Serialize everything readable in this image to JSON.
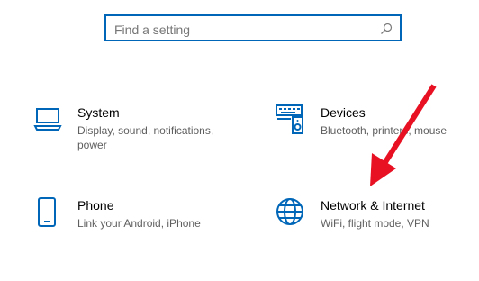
{
  "search": {
    "placeholder": "Find a setting"
  },
  "tiles": [
    {
      "title": "System",
      "description": "Display, sound, notifications, power",
      "icon": "laptop-icon"
    },
    {
      "title": "Devices",
      "description": "Bluetooth, printers, mouse",
      "icon": "keyboard-speaker-icon"
    },
    {
      "title": "Phone",
      "description": "Link your Android, iPhone",
      "icon": "phone-icon"
    },
    {
      "title": "Network & Internet",
      "description": "WiFi, flight mode, VPN",
      "icon": "globe-icon"
    }
  ],
  "colors": {
    "accent": "#0067b8",
    "arrow": "#e81123"
  },
  "annotation": {
    "icon": "red-arrow-icon"
  }
}
